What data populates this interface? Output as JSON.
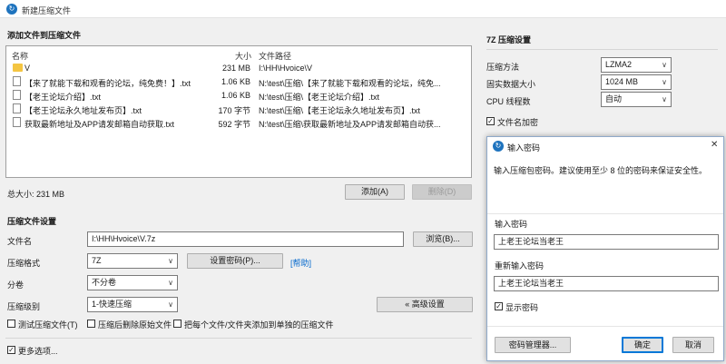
{
  "window": {
    "title": "新建压缩文件"
  },
  "files_section": {
    "title": "添加文件到压缩文件",
    "columns": {
      "name": "名称",
      "size": "大小",
      "path": "文件路径"
    },
    "rows": [
      {
        "icon": "folder",
        "name": "V",
        "size": "231 MB",
        "path": "I:\\HH\\Hvoice\\V"
      },
      {
        "icon": "file",
        "name": "【来了就能下载和观看的论坛，纯免费！】.txt",
        "size": "1.06 KB",
        "path": "N:\\test\\压缩\\【来了就能下载和观看的论坛，纯免..."
      },
      {
        "icon": "file",
        "name": "【老王论坛介绍】.txt",
        "size": "1.06 KB",
        "path": "N:\\test\\压缩\\【老王论坛介绍】.txt"
      },
      {
        "icon": "file",
        "name": "【老王论坛永久地址发布页】.txt",
        "size": "170 字节",
        "path": "N:\\test\\压缩\\【老王论坛永久地址发布页】.txt"
      },
      {
        "icon": "file",
        "name": "获取最新地址及APP请发邮箱自动获取.txt",
        "size": "592 字节",
        "path": "N:\\test\\压缩\\获取最新地址及APP请发邮箱自动获..."
      }
    ],
    "total_label": "总大小: 231 MB",
    "add_button": "添加(A)",
    "delete_button": "删除(D)"
  },
  "settings": {
    "title": "压缩文件设置",
    "filename_label": "文件名",
    "filename_value": "I:\\HH\\Hvoice\\V.7z",
    "browse_button": "浏览(B)...",
    "format_label": "压缩格式",
    "format_value": "7Z",
    "set_password_button": "设置密码(P)...",
    "help_link": "[帮助]",
    "split_label": "分卷",
    "split_value": "不分卷",
    "level_label": "压缩级别",
    "level_value": "1-快速压缩",
    "advanced_button": "« 高级设置",
    "test_checkbox": "测试压缩文件(T)",
    "delete_source_checkbox": "压缩后删除原始文件",
    "separate_checkbox": "把每个文件/文件夹添加到单独的压缩文件",
    "more_options_checkbox": "更多选项..."
  },
  "seven_zip": {
    "title": "7Z 压缩设置",
    "method_label": "压缩方法",
    "method_value": "LZMA2",
    "dict_label": "固实数据大小",
    "dict_value": "1024 MB",
    "cpu_label": "CPU 线程数",
    "cpu_value": "自动",
    "encrypt_names_label": "文件名加密"
  },
  "password_dialog": {
    "title": "输入密码",
    "description": "输入压缩包密码。建议使用至少 8 位的密码来保证安全性。",
    "password_label": "输入密码",
    "password_value": "上老王论坛当老王",
    "confirm_label": "重新输入密码",
    "confirm_value": "上老王论坛当老王",
    "show_password_label": "显示密码",
    "manager_button": "密码管理器...",
    "ok_button": "确定",
    "cancel_button": "取消"
  }
}
